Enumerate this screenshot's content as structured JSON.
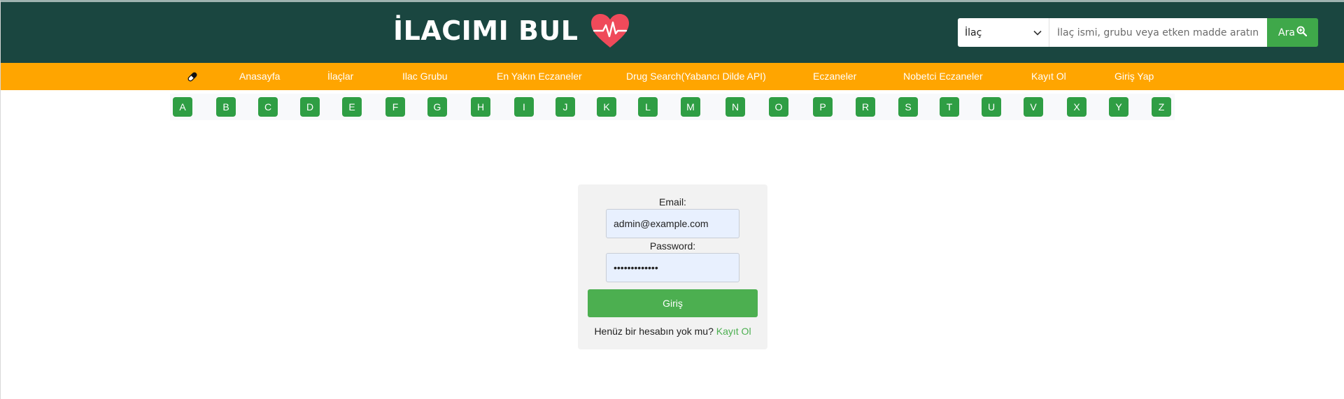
{
  "header": {
    "logo_text": "İLACIMI BUL",
    "search": {
      "type_selected": "İlaç",
      "placeholder": "İlaç ismi, grubu veya etken madde aratın",
      "button_label": "Ara"
    }
  },
  "nav": {
    "items": [
      "Anasayfa",
      "İlaçlar",
      "Ilac Grubu",
      "En Yakın Eczaneler",
      "Drug Search(Yabancı Dilde API)",
      "Eczaneler",
      "Nobetci Eczaneler",
      "Kayıt Ol",
      "Giriş Yap"
    ]
  },
  "alphabet": [
    "A",
    "B",
    "C",
    "D",
    "E",
    "F",
    "G",
    "H",
    "I",
    "J",
    "K",
    "L",
    "M",
    "N",
    "O",
    "P",
    "R",
    "S",
    "T",
    "U",
    "V",
    "X",
    "Y",
    "Z"
  ],
  "login": {
    "email_label": "Email:",
    "email_value": "admin@example.com",
    "password_label": "Password:",
    "password_value": "•••••••••••••",
    "submit_label": "Giriş",
    "signup_prompt": "Henüz bir hesabın yok mu?",
    "signup_link": "Kayıt Ol"
  },
  "colors": {
    "header_bg": "#1a4640",
    "nav_bg": "#ffa500",
    "accent_green": "#4caf50",
    "letter_green": "#2f9e44"
  }
}
